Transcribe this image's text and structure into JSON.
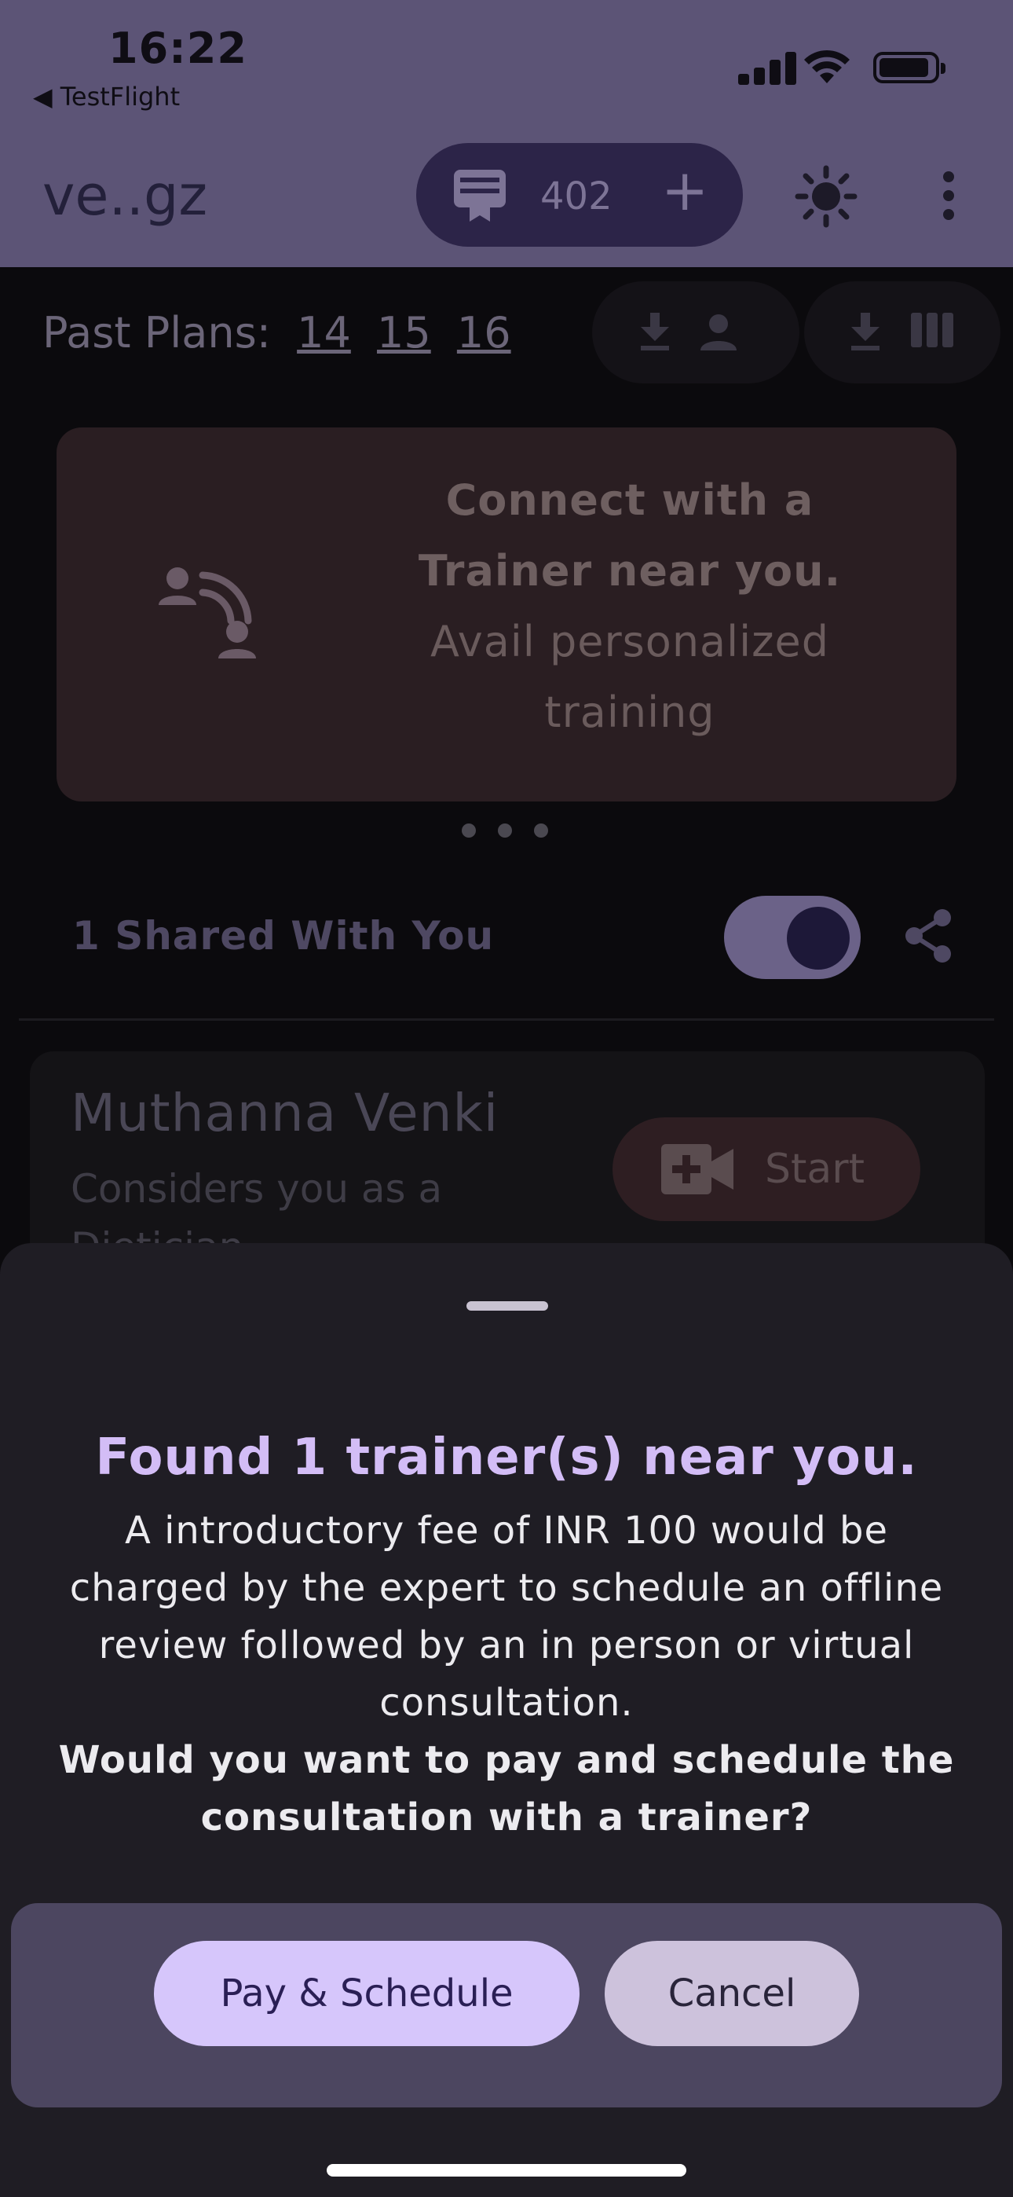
{
  "status_bar": {
    "time": "16:22",
    "back_app": "◀ TestFlight"
  },
  "app_bar": {
    "brand": "ve..gz",
    "credits": "402",
    "add_glyph": "+",
    "icons": [
      "receipt-badge-icon",
      "add-icon",
      "brightness-icon",
      "more-vert-icon"
    ]
  },
  "past_plans": {
    "label": "Past Plans:",
    "plans": [
      "14",
      "15",
      "16"
    ],
    "actions": [
      "download-profile",
      "download-columns"
    ]
  },
  "promo": {
    "title": "Connect with a Trainer near you.",
    "subtitle": "Avail personalized training",
    "icon": "connect-trainer-icon"
  },
  "shared": {
    "label": "1 Shared With You",
    "toggle_on": true
  },
  "trainer": {
    "name": "Muthanna Venki",
    "subtitle": "Considers you as a Dietician",
    "start_label": "Start"
  },
  "sheet": {
    "title": "Found 1 trainer(s) near you.",
    "body": "A introductory fee of INR 100  would be charged by the expert to schedule an offline review followed by an in person or virtual consultation.",
    "question": "Would you want to pay and schedule the consultation with a trainer?",
    "primary_label": "Pay & Schedule",
    "secondary_label": "Cancel"
  },
  "colors": {
    "accent": "#d6c6fb",
    "sheet_bg": "#1f1d24",
    "app_bar_bg": "#5c5476"
  }
}
